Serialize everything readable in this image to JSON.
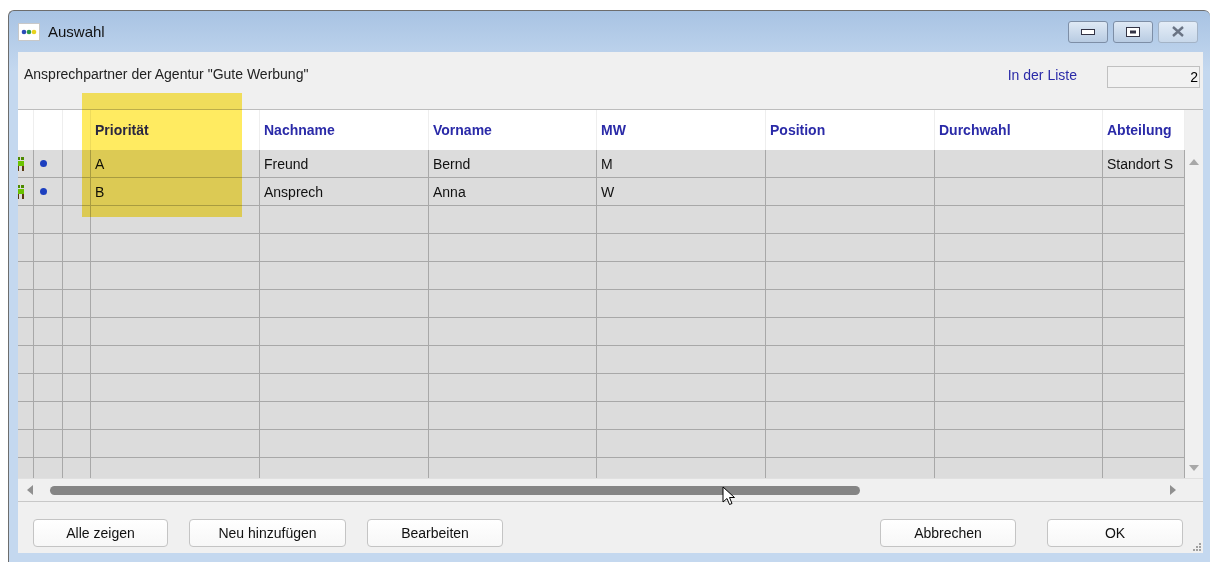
{
  "window": {
    "title": "Auswahl"
  },
  "header": {
    "subtitle": "Ansprechpartner der Agentur \"Gute Werbung\"",
    "count_label": "In der Liste",
    "count_value": "2"
  },
  "table": {
    "columns": [
      {
        "label": "Priorität",
        "highlighted": true
      },
      {
        "label": "Nachname",
        "highlighted": false
      },
      {
        "label": "Vorname",
        "highlighted": false
      },
      {
        "label": "MW",
        "highlighted": false
      },
      {
        "label": "Position",
        "highlighted": false
      },
      {
        "label": "Durchwahl",
        "highlighted": false
      },
      {
        "label": "Abteilung",
        "highlighted": false
      }
    ],
    "rows": [
      {
        "cells": [
          "A",
          "Freund",
          "Bernd",
          "M",
          null,
          null,
          "Standort S"
        ]
      },
      {
        "cells": [
          "B",
          "Ansprech",
          "Anna",
          "W",
          null,
          null,
          null
        ]
      }
    ]
  },
  "buttons_left": [
    "Alle zeigen",
    "Neu hinzufügen",
    "Bearbeiten"
  ],
  "buttons_right": [
    "Abbrechen",
    "OK"
  ]
}
